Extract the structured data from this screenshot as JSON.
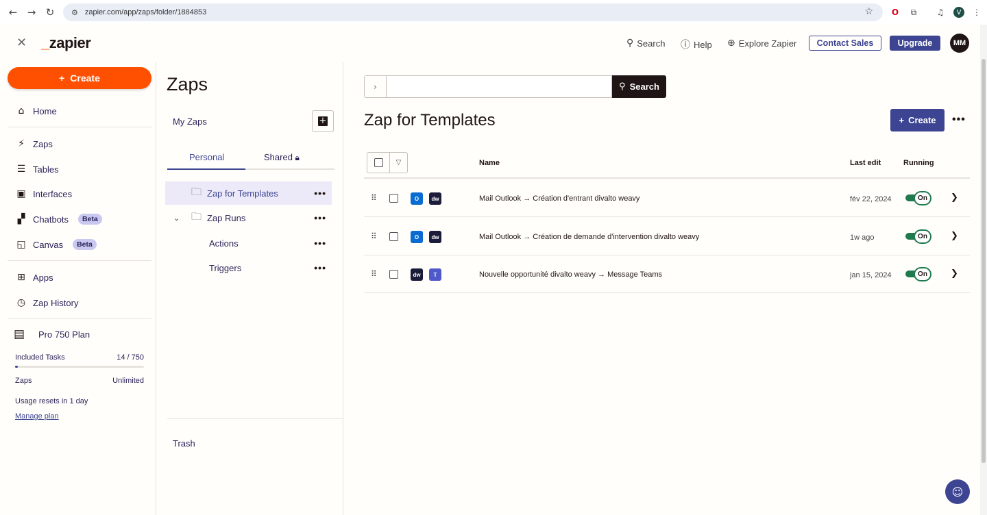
{
  "browser": {
    "url": "zapier.com/app/zaps/folder/1884853",
    "back_icon": "←",
    "forward_icon": "→",
    "reload_icon": "↻",
    "profile_initial": "V"
  },
  "topbar": {
    "logo_prefix": "_",
    "logo_text": "zapier",
    "search_label": "Search",
    "help_label": "Help",
    "explore_label": "Explore Zapier",
    "contact_sales_label": "Contact Sales",
    "upgrade_label": "Upgrade",
    "user_initials": "MM"
  },
  "sidebar": {
    "create_label": "Create",
    "items": [
      {
        "label": "Home",
        "icon": "⌂"
      },
      {
        "label": "Zaps",
        "icon": "⚡"
      },
      {
        "label": "Tables",
        "icon": "☰"
      },
      {
        "label": "Interfaces",
        "icon": "▣"
      },
      {
        "label": "Chatbots",
        "icon": "▞",
        "badge": "Beta"
      },
      {
        "label": "Canvas",
        "icon": "◱",
        "badge": "Beta"
      },
      {
        "label": "Apps",
        "icon": "⊞"
      },
      {
        "label": "Zap History",
        "icon": "◷"
      }
    ],
    "plan": {
      "name": "Pro 750 Plan",
      "tasks_label": "Included Tasks",
      "tasks_value": "14 / 750",
      "tasks_used_fraction": 0.019,
      "zaps_label": "Zaps",
      "zaps_value": "Unlimited",
      "reset_text": "Usage resets in 1 day",
      "manage_label": "Manage plan"
    }
  },
  "folders": {
    "title": "Zaps",
    "section_label": "My Zaps",
    "tabs": {
      "personal": "Personal",
      "shared": "Shared"
    },
    "items": [
      {
        "label": "Zap for Templates"
      },
      {
        "label": "Zap Runs"
      },
      {
        "label": "Actions"
      },
      {
        "label": "Triggers"
      }
    ],
    "trash_label": "Trash"
  },
  "main": {
    "search_placeholder": "",
    "search_button": "Search",
    "folder_title": "Zap for Templates",
    "create_label": "Create",
    "columns": {
      "name": "Name",
      "last_edit": "Last edit",
      "running": "Running"
    },
    "rows": [
      {
        "apps": [
          "O",
          "dw"
        ],
        "name": "Mail Outlook → Création d'entrant divalto weavy",
        "last_edit": "fév 22, 2024",
        "status": "On"
      },
      {
        "apps": [
          "O",
          "dw"
        ],
        "name": "Mail Outlook → Création de demande d'intervention divalto weavy",
        "last_edit": "1w ago",
        "status": "On"
      },
      {
        "apps": [
          "dw",
          "T"
        ],
        "name": "Nouvelle opportunité divalto weavy → Message Teams",
        "last_edit": "jan 15, 2024",
        "status": "On"
      }
    ]
  },
  "colors": {
    "brand_orange": "#ff4f00",
    "primary": "#3d4592",
    "toggle_on": "#1f7a4d"
  }
}
